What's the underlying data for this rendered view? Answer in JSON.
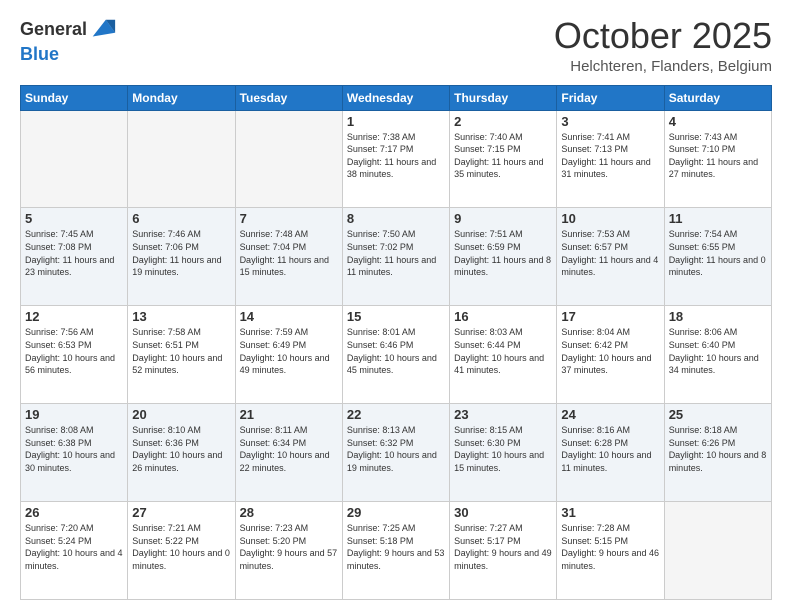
{
  "header": {
    "logo_general": "General",
    "logo_blue": "Blue",
    "month": "October 2025",
    "location": "Helchteren, Flanders, Belgium"
  },
  "days_of_week": [
    "Sunday",
    "Monday",
    "Tuesday",
    "Wednesday",
    "Thursday",
    "Friday",
    "Saturday"
  ],
  "weeks": [
    [
      {
        "day": "",
        "info": ""
      },
      {
        "day": "",
        "info": ""
      },
      {
        "day": "",
        "info": ""
      },
      {
        "day": "1",
        "info": "Sunrise: 7:38 AM\nSunset: 7:17 PM\nDaylight: 11 hours\nand 38 minutes."
      },
      {
        "day": "2",
        "info": "Sunrise: 7:40 AM\nSunset: 7:15 PM\nDaylight: 11 hours\nand 35 minutes."
      },
      {
        "day": "3",
        "info": "Sunrise: 7:41 AM\nSunset: 7:13 PM\nDaylight: 11 hours\nand 31 minutes."
      },
      {
        "day": "4",
        "info": "Sunrise: 7:43 AM\nSunset: 7:10 PM\nDaylight: 11 hours\nand 27 minutes."
      }
    ],
    [
      {
        "day": "5",
        "info": "Sunrise: 7:45 AM\nSunset: 7:08 PM\nDaylight: 11 hours\nand 23 minutes."
      },
      {
        "day": "6",
        "info": "Sunrise: 7:46 AM\nSunset: 7:06 PM\nDaylight: 11 hours\nand 19 minutes."
      },
      {
        "day": "7",
        "info": "Sunrise: 7:48 AM\nSunset: 7:04 PM\nDaylight: 11 hours\nand 15 minutes."
      },
      {
        "day": "8",
        "info": "Sunrise: 7:50 AM\nSunset: 7:02 PM\nDaylight: 11 hours\nand 11 minutes."
      },
      {
        "day": "9",
        "info": "Sunrise: 7:51 AM\nSunset: 6:59 PM\nDaylight: 11 hours\nand 8 minutes."
      },
      {
        "day": "10",
        "info": "Sunrise: 7:53 AM\nSunset: 6:57 PM\nDaylight: 11 hours\nand 4 minutes."
      },
      {
        "day": "11",
        "info": "Sunrise: 7:54 AM\nSunset: 6:55 PM\nDaylight: 11 hours\nand 0 minutes."
      }
    ],
    [
      {
        "day": "12",
        "info": "Sunrise: 7:56 AM\nSunset: 6:53 PM\nDaylight: 10 hours\nand 56 minutes."
      },
      {
        "day": "13",
        "info": "Sunrise: 7:58 AM\nSunset: 6:51 PM\nDaylight: 10 hours\nand 52 minutes."
      },
      {
        "day": "14",
        "info": "Sunrise: 7:59 AM\nSunset: 6:49 PM\nDaylight: 10 hours\nand 49 minutes."
      },
      {
        "day": "15",
        "info": "Sunrise: 8:01 AM\nSunset: 6:46 PM\nDaylight: 10 hours\nand 45 minutes."
      },
      {
        "day": "16",
        "info": "Sunrise: 8:03 AM\nSunset: 6:44 PM\nDaylight: 10 hours\nand 41 minutes."
      },
      {
        "day": "17",
        "info": "Sunrise: 8:04 AM\nSunset: 6:42 PM\nDaylight: 10 hours\nand 37 minutes."
      },
      {
        "day": "18",
        "info": "Sunrise: 8:06 AM\nSunset: 6:40 PM\nDaylight: 10 hours\nand 34 minutes."
      }
    ],
    [
      {
        "day": "19",
        "info": "Sunrise: 8:08 AM\nSunset: 6:38 PM\nDaylight: 10 hours\nand 30 minutes."
      },
      {
        "day": "20",
        "info": "Sunrise: 8:10 AM\nSunset: 6:36 PM\nDaylight: 10 hours\nand 26 minutes."
      },
      {
        "day": "21",
        "info": "Sunrise: 8:11 AM\nSunset: 6:34 PM\nDaylight: 10 hours\nand 22 minutes."
      },
      {
        "day": "22",
        "info": "Sunrise: 8:13 AM\nSunset: 6:32 PM\nDaylight: 10 hours\nand 19 minutes."
      },
      {
        "day": "23",
        "info": "Sunrise: 8:15 AM\nSunset: 6:30 PM\nDaylight: 10 hours\nand 15 minutes."
      },
      {
        "day": "24",
        "info": "Sunrise: 8:16 AM\nSunset: 6:28 PM\nDaylight: 10 hours\nand 11 minutes."
      },
      {
        "day": "25",
        "info": "Sunrise: 8:18 AM\nSunset: 6:26 PM\nDaylight: 10 hours\nand 8 minutes."
      }
    ],
    [
      {
        "day": "26",
        "info": "Sunrise: 7:20 AM\nSunset: 5:24 PM\nDaylight: 10 hours\nand 4 minutes."
      },
      {
        "day": "27",
        "info": "Sunrise: 7:21 AM\nSunset: 5:22 PM\nDaylight: 10 hours\nand 0 minutes."
      },
      {
        "day": "28",
        "info": "Sunrise: 7:23 AM\nSunset: 5:20 PM\nDaylight: 9 hours\nand 57 minutes."
      },
      {
        "day": "29",
        "info": "Sunrise: 7:25 AM\nSunset: 5:18 PM\nDaylight: 9 hours\nand 53 minutes."
      },
      {
        "day": "30",
        "info": "Sunrise: 7:27 AM\nSunset: 5:17 PM\nDaylight: 9 hours\nand 49 minutes."
      },
      {
        "day": "31",
        "info": "Sunrise: 7:28 AM\nSunset: 5:15 PM\nDaylight: 9 hours\nand 46 minutes."
      },
      {
        "day": "",
        "info": ""
      }
    ]
  ]
}
